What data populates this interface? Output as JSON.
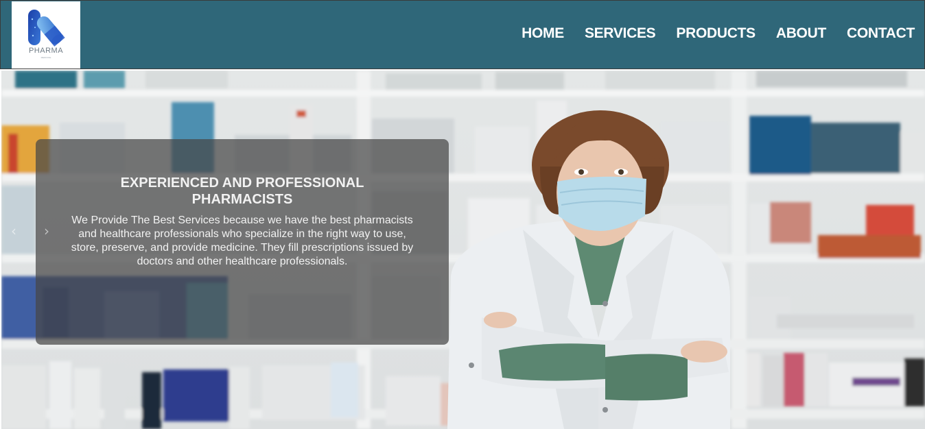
{
  "header": {
    "logo": {
      "brand": "PHARMA",
      "tagline": "MEDICINE",
      "icon": "capsule-logo-icon",
      "colors": {
        "primary": "#2a5cc7",
        "light": "#6fb2ef"
      }
    },
    "nav": [
      {
        "label": "HOME"
      },
      {
        "label": "SERVICES"
      },
      {
        "label": "PRODUCTS"
      },
      {
        "label": "ABOUT"
      },
      {
        "label": "CONTACT"
      }
    ],
    "background": "#2f6779"
  },
  "hero": {
    "image": "pharmacist-with-mask-photo",
    "title": "EXPERIENCED AND PROFESSIONAL PHARMACISTS",
    "description": "We Provide The Best Services because we have the best pharmacists and healthcare professionals who specialize in the right way to use, store, preserve, and provide medicine. They fill prescriptions issued by doctors and other healthcare professionals.",
    "prev_icon": "chevron-left-icon",
    "next_icon": "chevron-right-icon"
  }
}
